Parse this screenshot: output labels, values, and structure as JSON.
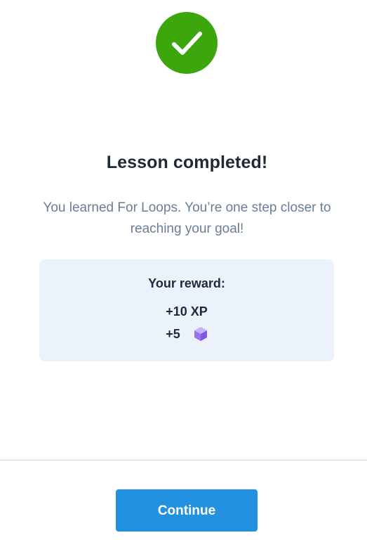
{
  "status": {
    "icon": "check-icon",
    "color": "#3ca60d"
  },
  "title": "Lesson completed!",
  "subtitle": "You learned For Loops. You’re one step closer to reaching your goal!",
  "reward": {
    "title": "Your reward:",
    "xp": "+10 XP",
    "gems": "+5",
    "gem_icon": "gem-icon"
  },
  "continue_label": "Continue",
  "colors": {
    "accent": "#2191e0",
    "success": "#3ca60d",
    "reward_bg": "#ebf2fc"
  }
}
